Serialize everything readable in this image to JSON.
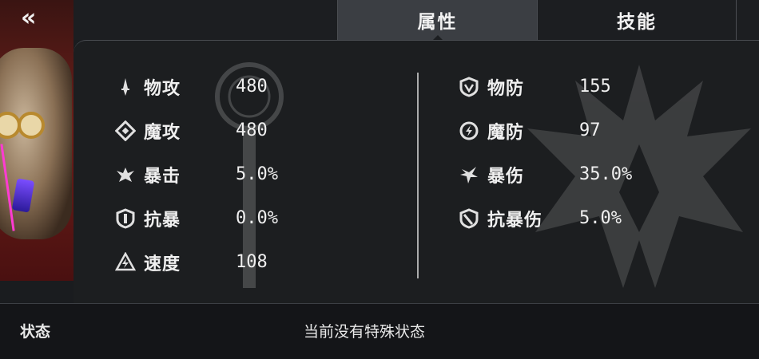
{
  "nav": {
    "back_glyph": "«"
  },
  "tabs": [
    {
      "label": "属性",
      "active": true
    },
    {
      "label": "技能",
      "active": false
    }
  ],
  "stats_left": [
    {
      "icon": "sword-icon",
      "label": "物攻",
      "value": "480"
    },
    {
      "icon": "magic-diamond-icon",
      "label": "魔攻",
      "value": "480"
    },
    {
      "icon": "crit-burst-icon",
      "label": "暴击",
      "value": "5.0%"
    },
    {
      "icon": "crit-resist-shield-icon",
      "label": "抗暴",
      "value": "0.0%"
    },
    {
      "icon": "speed-bolt-icon",
      "label": "速度",
      "value": "108"
    }
  ],
  "stats_right": [
    {
      "icon": "physical-defense-shield-icon",
      "label": "物防",
      "value": "155"
    },
    {
      "icon": "magic-defense-swirl-icon",
      "label": "魔防",
      "value": "97"
    },
    {
      "icon": "crit-damage-icon",
      "label": "暴伤",
      "value": "35.0%"
    },
    {
      "icon": "crit-damage-resist-icon",
      "label": "抗暴伤",
      "value": "5.0%"
    }
  ],
  "status": {
    "label": "状态",
    "text": "当前没有特殊状态"
  },
  "colors": {
    "background": "#1a1c1f",
    "tab_active": "#3b3e43",
    "text": "#f0f0f0",
    "portrait_red": "#6d1f1a"
  }
}
